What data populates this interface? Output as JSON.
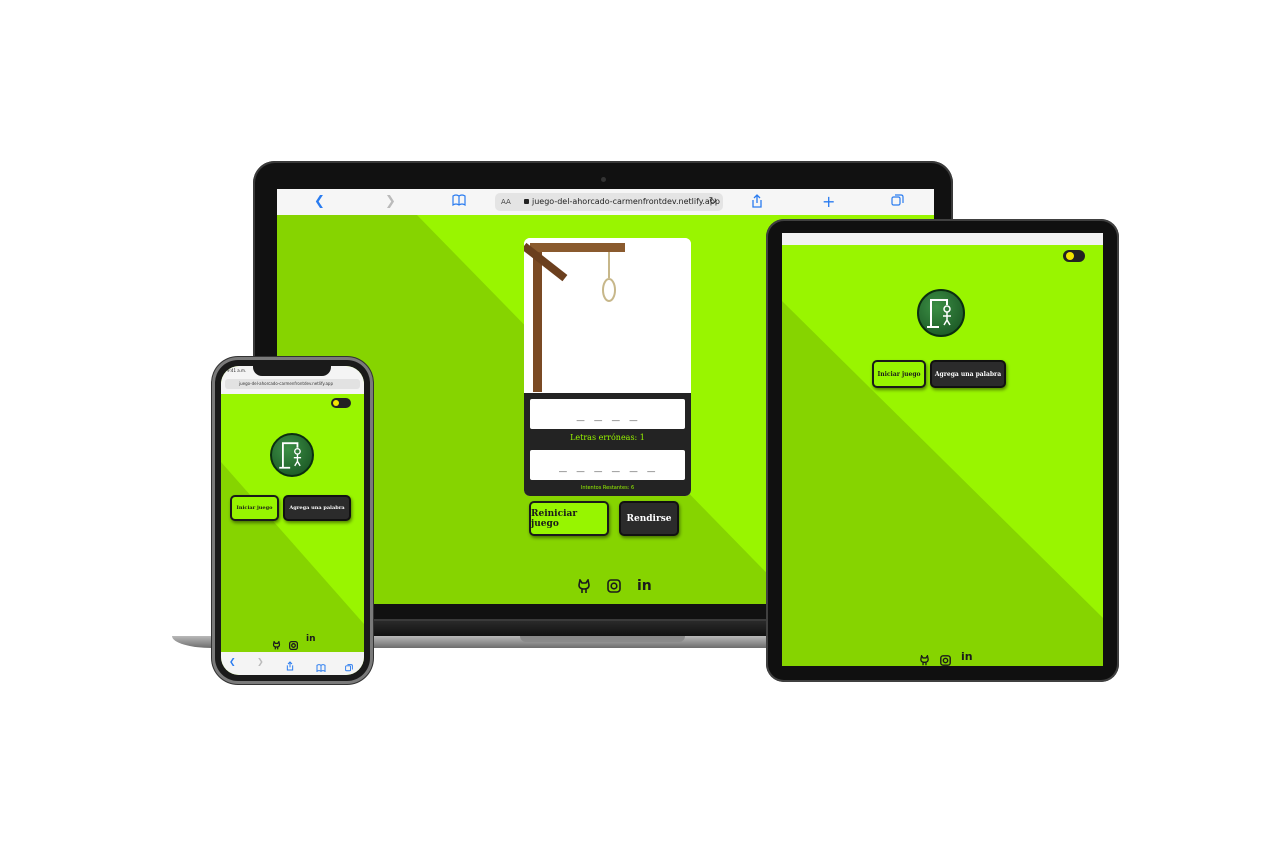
{
  "browser": {
    "url": "juego-del-ahorcado-carmenfrontdev.netlify.app",
    "aa_label": "AA"
  },
  "laptop": {
    "hidden_word": "_ _ _ _",
    "wrong_label": "Letras erróneas: 1",
    "wrong_letters": "_ _ _ _ _ _",
    "tries_label": "Intentos Restantes: 6",
    "restart_button": "Reiniciar juego",
    "surrender_button": "Rendirse"
  },
  "tablet": {
    "start_button": "Iniciar juego",
    "add_word_button": "Agrega una palabra"
  },
  "phone": {
    "status_time": "9:41 a.m.",
    "url": "juego-del-ahorcado-carmenfrontdev.netlify.app",
    "start_button": "Iniciar juego",
    "add_word_button": "Agrega una palabra"
  },
  "social": {
    "github": "github-icon",
    "instagram": "instagram-icon",
    "linkedin": "in"
  },
  "colors": {
    "bg_green": "#86d400",
    "light_green": "#99f500",
    "dark": "#232323"
  }
}
